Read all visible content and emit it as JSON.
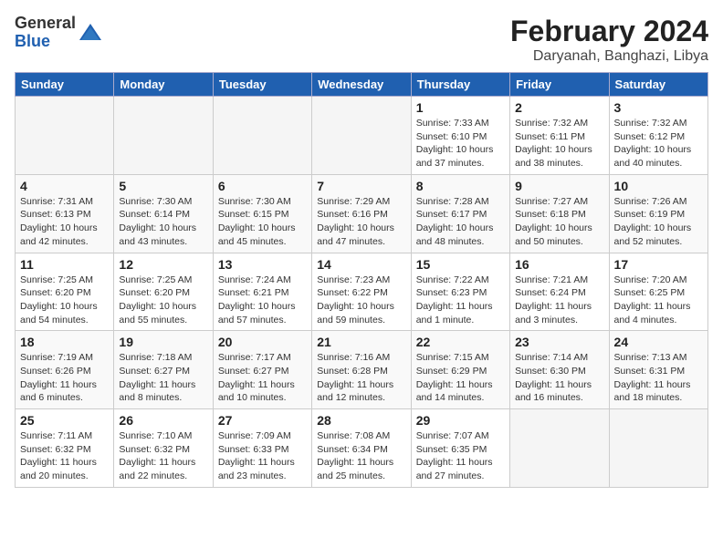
{
  "header": {
    "logo_general": "General",
    "logo_blue": "Blue",
    "title": "February 2024",
    "subtitle": "Daryanah, Banghazi, Libya"
  },
  "weekdays": [
    "Sunday",
    "Monday",
    "Tuesday",
    "Wednesday",
    "Thursday",
    "Friday",
    "Saturday"
  ],
  "weeks": [
    [
      {
        "day": "",
        "info": ""
      },
      {
        "day": "",
        "info": ""
      },
      {
        "day": "",
        "info": ""
      },
      {
        "day": "",
        "info": ""
      },
      {
        "day": "1",
        "info": "Sunrise: 7:33 AM\nSunset: 6:10 PM\nDaylight: 10 hours\nand 37 minutes."
      },
      {
        "day": "2",
        "info": "Sunrise: 7:32 AM\nSunset: 6:11 PM\nDaylight: 10 hours\nand 38 minutes."
      },
      {
        "day": "3",
        "info": "Sunrise: 7:32 AM\nSunset: 6:12 PM\nDaylight: 10 hours\nand 40 minutes."
      }
    ],
    [
      {
        "day": "4",
        "info": "Sunrise: 7:31 AM\nSunset: 6:13 PM\nDaylight: 10 hours\nand 42 minutes."
      },
      {
        "day": "5",
        "info": "Sunrise: 7:30 AM\nSunset: 6:14 PM\nDaylight: 10 hours\nand 43 minutes."
      },
      {
        "day": "6",
        "info": "Sunrise: 7:30 AM\nSunset: 6:15 PM\nDaylight: 10 hours\nand 45 minutes."
      },
      {
        "day": "7",
        "info": "Sunrise: 7:29 AM\nSunset: 6:16 PM\nDaylight: 10 hours\nand 47 minutes."
      },
      {
        "day": "8",
        "info": "Sunrise: 7:28 AM\nSunset: 6:17 PM\nDaylight: 10 hours\nand 48 minutes."
      },
      {
        "day": "9",
        "info": "Sunrise: 7:27 AM\nSunset: 6:18 PM\nDaylight: 10 hours\nand 50 minutes."
      },
      {
        "day": "10",
        "info": "Sunrise: 7:26 AM\nSunset: 6:19 PM\nDaylight: 10 hours\nand 52 minutes."
      }
    ],
    [
      {
        "day": "11",
        "info": "Sunrise: 7:25 AM\nSunset: 6:20 PM\nDaylight: 10 hours\nand 54 minutes."
      },
      {
        "day": "12",
        "info": "Sunrise: 7:25 AM\nSunset: 6:20 PM\nDaylight: 10 hours\nand 55 minutes."
      },
      {
        "day": "13",
        "info": "Sunrise: 7:24 AM\nSunset: 6:21 PM\nDaylight: 10 hours\nand 57 minutes."
      },
      {
        "day": "14",
        "info": "Sunrise: 7:23 AM\nSunset: 6:22 PM\nDaylight: 10 hours\nand 59 minutes."
      },
      {
        "day": "15",
        "info": "Sunrise: 7:22 AM\nSunset: 6:23 PM\nDaylight: 11 hours\nand 1 minute."
      },
      {
        "day": "16",
        "info": "Sunrise: 7:21 AM\nSunset: 6:24 PM\nDaylight: 11 hours\nand 3 minutes."
      },
      {
        "day": "17",
        "info": "Sunrise: 7:20 AM\nSunset: 6:25 PM\nDaylight: 11 hours\nand 4 minutes."
      }
    ],
    [
      {
        "day": "18",
        "info": "Sunrise: 7:19 AM\nSunset: 6:26 PM\nDaylight: 11 hours\nand 6 minutes."
      },
      {
        "day": "19",
        "info": "Sunrise: 7:18 AM\nSunset: 6:27 PM\nDaylight: 11 hours\nand 8 minutes."
      },
      {
        "day": "20",
        "info": "Sunrise: 7:17 AM\nSunset: 6:27 PM\nDaylight: 11 hours\nand 10 minutes."
      },
      {
        "day": "21",
        "info": "Sunrise: 7:16 AM\nSunset: 6:28 PM\nDaylight: 11 hours\nand 12 minutes."
      },
      {
        "day": "22",
        "info": "Sunrise: 7:15 AM\nSunset: 6:29 PM\nDaylight: 11 hours\nand 14 minutes."
      },
      {
        "day": "23",
        "info": "Sunrise: 7:14 AM\nSunset: 6:30 PM\nDaylight: 11 hours\nand 16 minutes."
      },
      {
        "day": "24",
        "info": "Sunrise: 7:13 AM\nSunset: 6:31 PM\nDaylight: 11 hours\nand 18 minutes."
      }
    ],
    [
      {
        "day": "25",
        "info": "Sunrise: 7:11 AM\nSunset: 6:32 PM\nDaylight: 11 hours\nand 20 minutes."
      },
      {
        "day": "26",
        "info": "Sunrise: 7:10 AM\nSunset: 6:32 PM\nDaylight: 11 hours\nand 22 minutes."
      },
      {
        "day": "27",
        "info": "Sunrise: 7:09 AM\nSunset: 6:33 PM\nDaylight: 11 hours\nand 23 minutes."
      },
      {
        "day": "28",
        "info": "Sunrise: 7:08 AM\nSunset: 6:34 PM\nDaylight: 11 hours\nand 25 minutes."
      },
      {
        "day": "29",
        "info": "Sunrise: 7:07 AM\nSunset: 6:35 PM\nDaylight: 11 hours\nand 27 minutes."
      },
      {
        "day": "",
        "info": ""
      },
      {
        "day": "",
        "info": ""
      }
    ]
  ]
}
